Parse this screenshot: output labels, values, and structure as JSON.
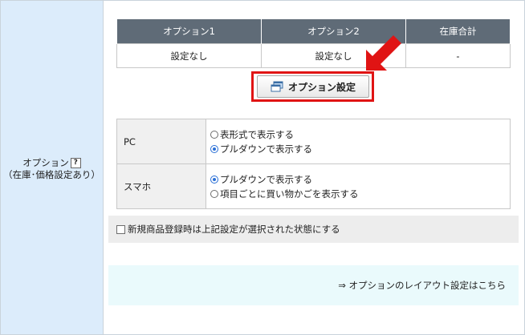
{
  "left": {
    "label_line1": "オプション",
    "help_mark": "?",
    "label_line2": "（在庫･価格設定あり）"
  },
  "option_table": {
    "headers": [
      "オプション1",
      "オプション2",
      "在庫合計"
    ],
    "row": [
      "設定なし",
      "設定なし",
      "-"
    ]
  },
  "option_button": {
    "label": "オプション設定",
    "icon": "window-stack-icon"
  },
  "annotation": {
    "arrow_color": "#e01414",
    "highlight_color": "#e01414"
  },
  "display_settings": {
    "pc": {
      "label": "PC",
      "options": [
        "表形式で表示する",
        "プルダウンで表示する"
      ],
      "selected": 1
    },
    "smartphone": {
      "label": "スマホ",
      "options": [
        "プルダウンで表示する",
        "項目ごとに買い物かごを表示する"
      ],
      "selected": 0
    }
  },
  "default_checkbox": {
    "label": "新規商品登録時は上記設定が選択された状態にする",
    "checked": false
  },
  "layout_link": {
    "text": "⇒ オプションのレイアウト設定はこちら"
  },
  "colors": {
    "left_panel": "#dcecfb",
    "table_header": "#5f6b77",
    "link_box": "#eafafc",
    "radio_checked": "#2a6fd6"
  }
}
